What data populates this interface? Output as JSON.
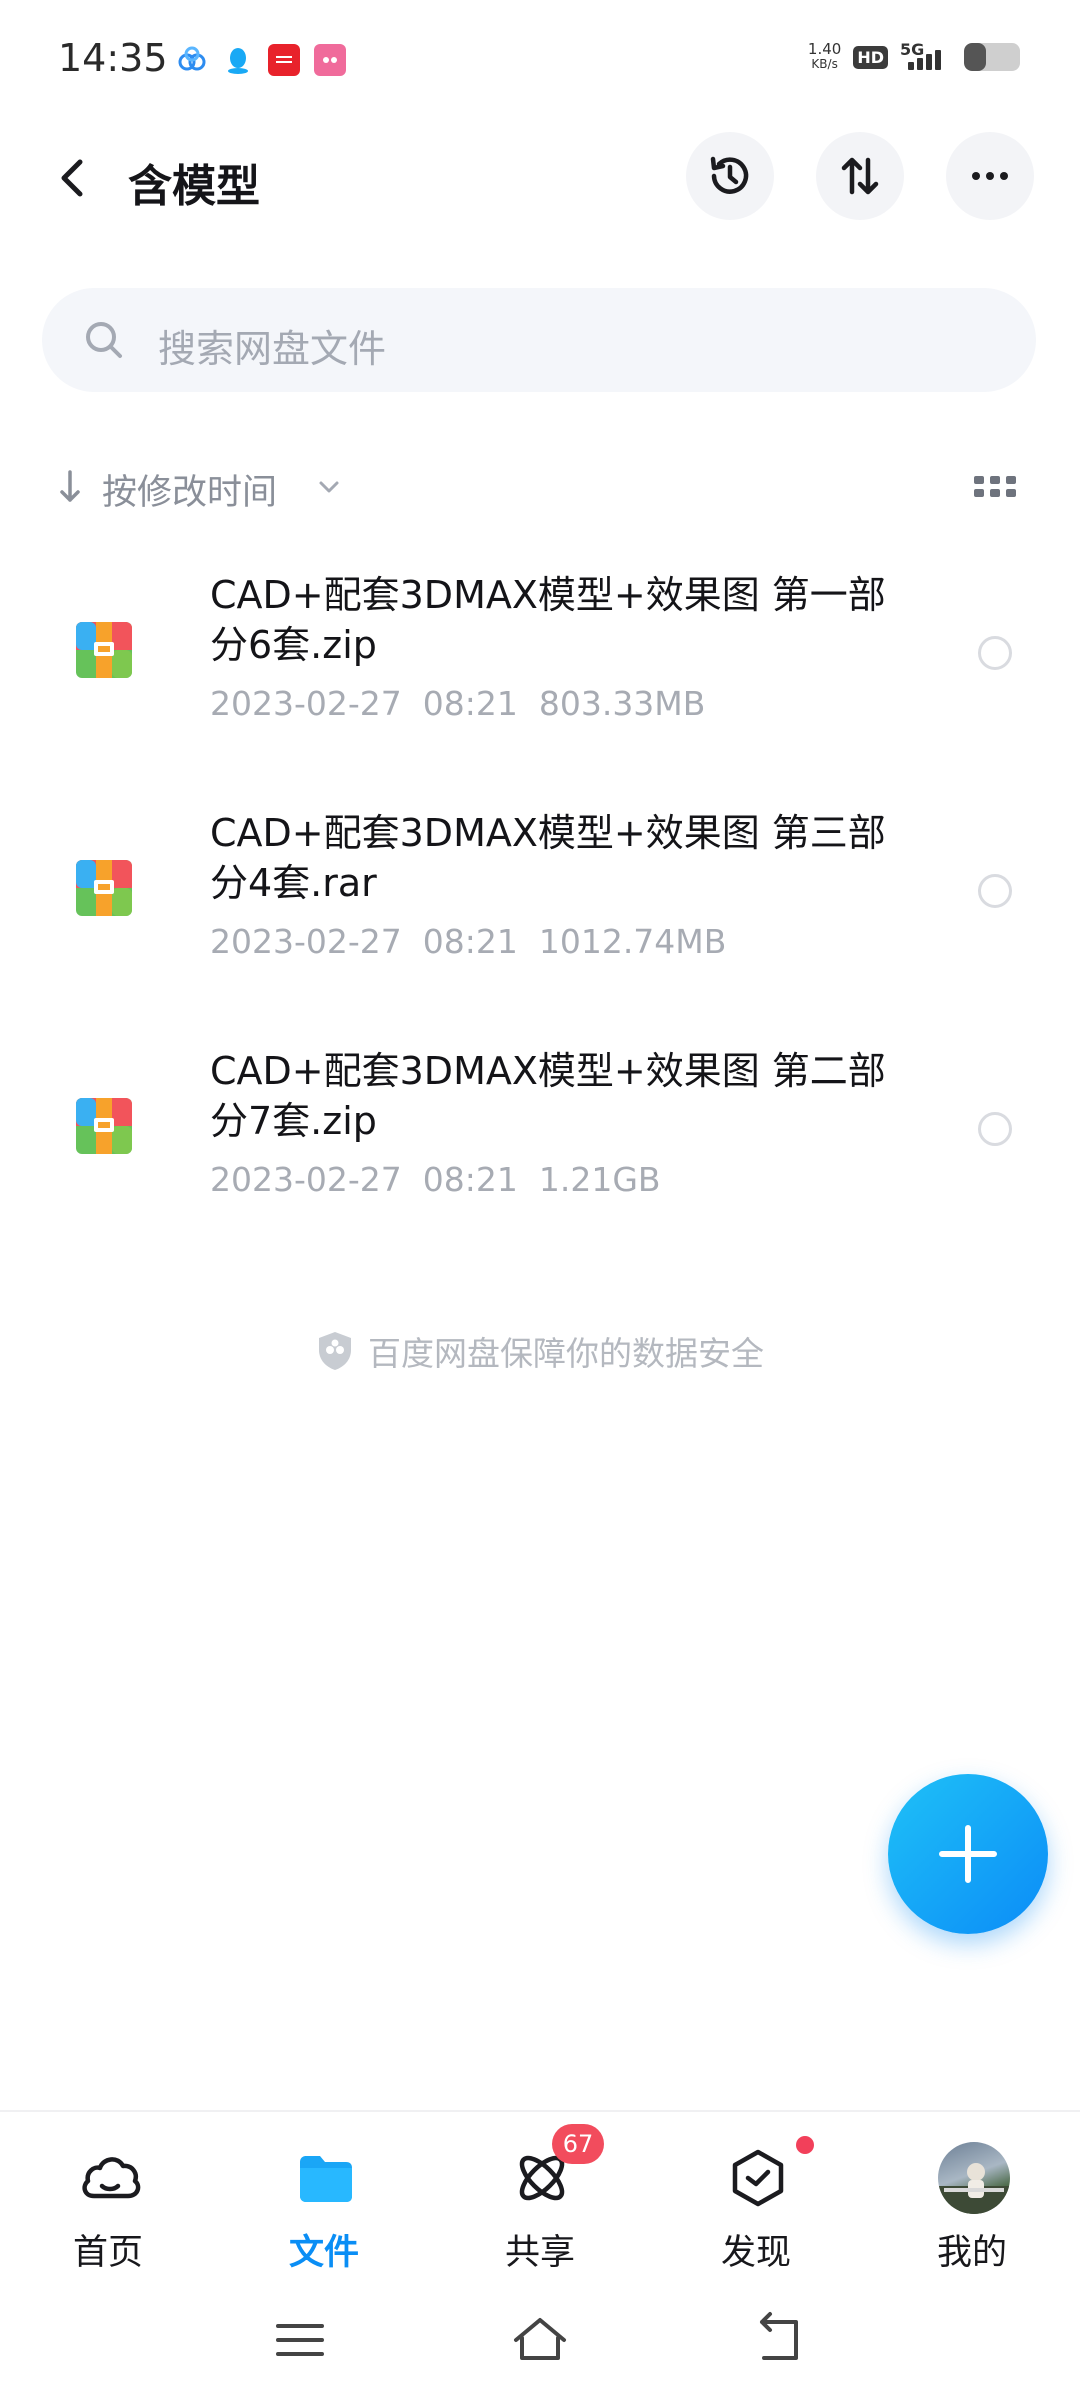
{
  "status_bar": {
    "time": "14:35",
    "speed_value": "1.40",
    "speed_unit": "KB/s",
    "hd_label": "HD",
    "network": "5G",
    "battery_percent": 40,
    "app_icons": [
      "baidu-netdisk-icon",
      "qq-icon",
      "app-red-icon",
      "app-pink-icon"
    ]
  },
  "header": {
    "title": "含模型",
    "back_icon": "chevron-left-icon",
    "history_icon": "history-icon",
    "transfer_icon": "transfer-icon",
    "more_icon": "more-icon"
  },
  "search": {
    "placeholder": "搜索网盘文件"
  },
  "sort": {
    "label": "按修改时间",
    "view_icon": "grid-view-icon"
  },
  "files": [
    {
      "name": "CAD+配套3DMAX模型+效果图 第一部分6套.zip",
      "meta": "2023-02-27  08:21  803.33MB"
    },
    {
      "name": "CAD+配套3DMAX模型+效果图 第三部分4套.rar",
      "meta": "2023-02-27  08:21  1012.74MB"
    },
    {
      "name": "CAD+配套3DMAX模型+效果图 第二部分7套.zip",
      "meta": "2023-02-27  08:21  1.21GB"
    }
  ],
  "safety_note": "百度网盘保障你的数据安全",
  "colors": {
    "accent": "#0a8ef5",
    "fab_start": "#1fc1f7",
    "fab_end": "#0b8cf7",
    "badge": "#f24c5d",
    "muted_text": "#a7abb3"
  },
  "bottom_nav": {
    "items": [
      {
        "label": "首页",
        "icon": "cloud-face-icon"
      },
      {
        "label": "文件",
        "icon": "folder-icon",
        "active": true
      },
      {
        "label": "共享",
        "icon": "atom-icon",
        "badge": "67"
      },
      {
        "label": "发现",
        "icon": "discover-box-icon",
        "dot": true
      },
      {
        "label": "我的",
        "icon": "avatar-icon"
      }
    ]
  }
}
